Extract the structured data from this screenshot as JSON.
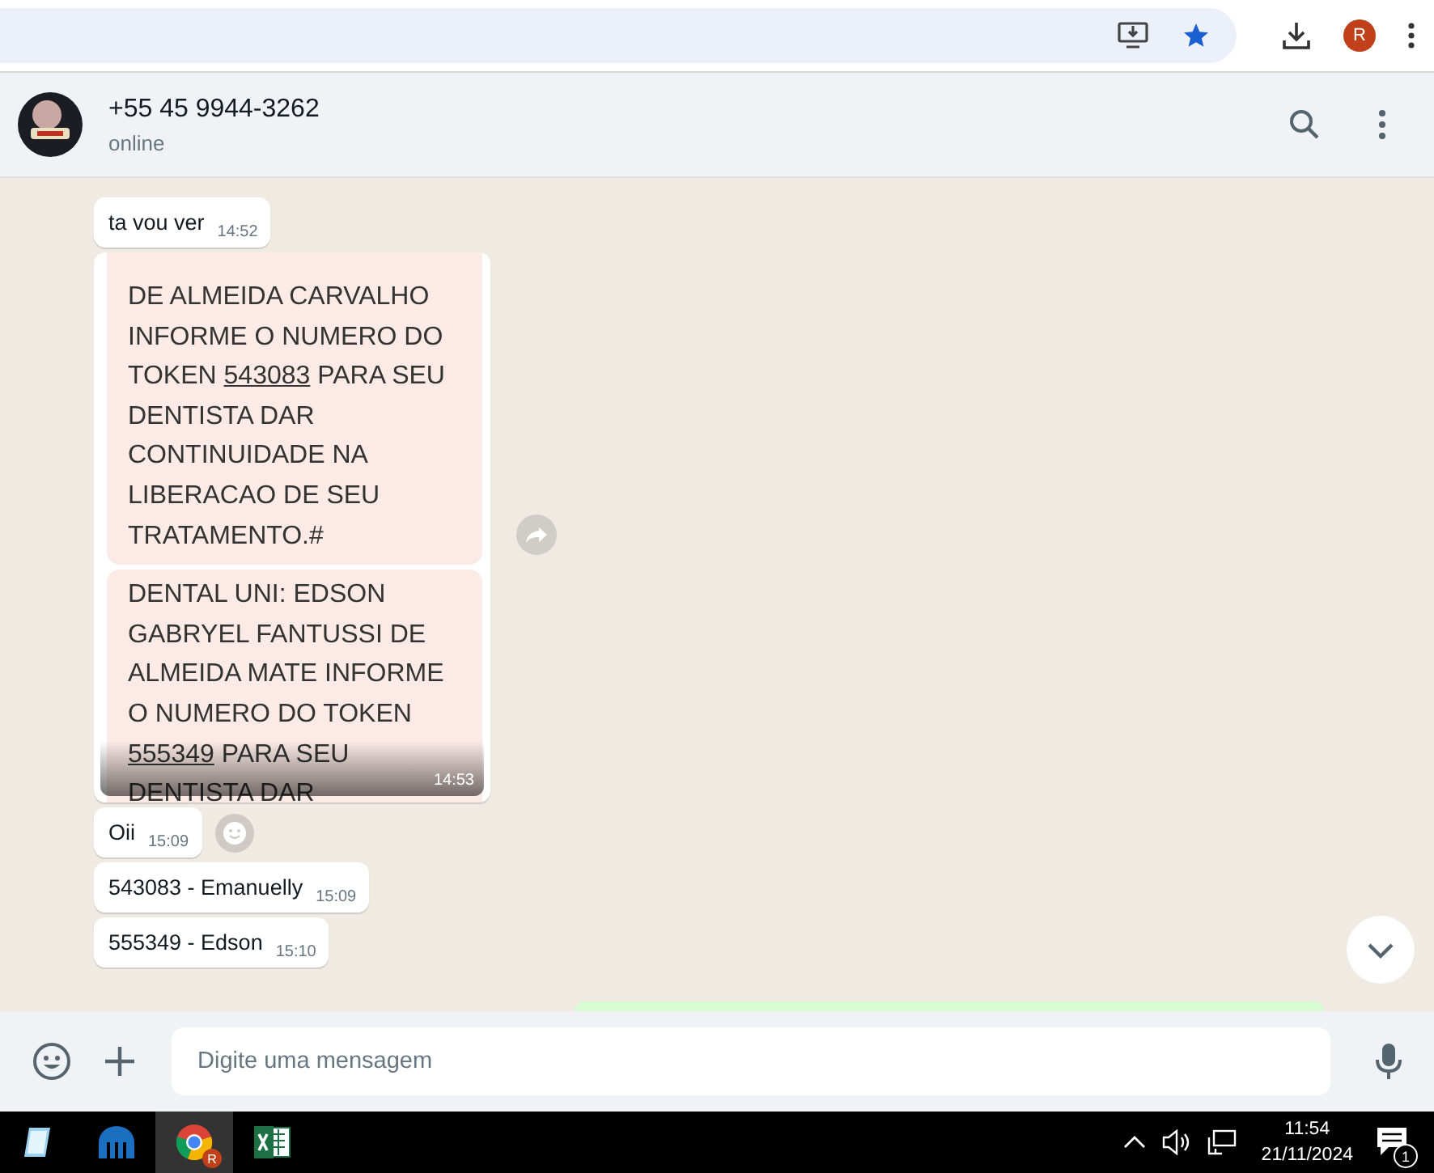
{
  "browser": {
    "bookmarked": true,
    "profile_initial": "R"
  },
  "chat": {
    "title": "+55 45 9944-3262",
    "status": "online"
  },
  "messages": [
    {
      "kind": "text",
      "text": "ta vou ver",
      "time": "14:52",
      "reaction_button": false
    },
    {
      "kind": "image",
      "time": "14:53",
      "blocks": [
        {
          "before": "DE ALMEIDA CARVALHO INFORME O NUMERO DO TOKEN ",
          "token": "543083",
          "after": " PARA SEU DENTISTA DAR CONTINUIDADE NA LIBERACAO DE SEU TRATAMENTO.#"
        },
        {
          "before": "DENTAL UNI: EDSON GABRYEL FANTUSSI DE ALMEIDA MATE INFORME O NUMERO DO TOKEN ",
          "token": "555349",
          "after": " PARA SEU DENTISTA DAR"
        }
      ]
    },
    {
      "kind": "text",
      "text": "Oii",
      "time": "15:09",
      "reaction_button": true
    },
    {
      "kind": "text",
      "text": "543083 - Emanuelly",
      "time": "15:09",
      "reaction_button": false
    },
    {
      "kind": "text",
      "text": "555349 - Edson",
      "time": "15:10",
      "reaction_button": false
    }
  ],
  "composer": {
    "placeholder": "Digite uma mensagem"
  },
  "taskbar": {
    "apps": [
      {
        "kind": "notepad",
        "selected": false
      },
      {
        "kind": "blue",
        "selected": false
      },
      {
        "kind": "chrome",
        "selected": true,
        "badge": "R"
      },
      {
        "kind": "excel",
        "selected": false
      }
    ],
    "time": "11:54",
    "date": "21/11/2024",
    "notifications": "1"
  }
}
